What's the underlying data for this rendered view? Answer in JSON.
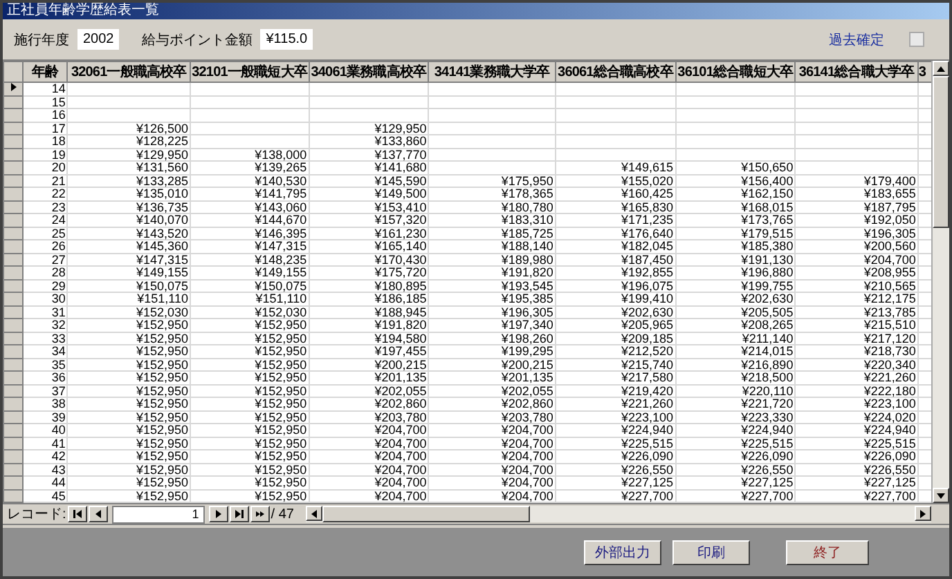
{
  "window": {
    "title": "正社員年齢学歴給表一覧"
  },
  "filters": {
    "year_label": "施行年度",
    "year_value": "2002",
    "point_label": "給与ポイント金額",
    "point_value": "¥115.0",
    "confirmed_label": "過去確定",
    "confirmed_checked": false
  },
  "table": {
    "columns": [
      "年齢",
      "32061一般職高校卒",
      "32101一般職短大卒",
      "34061業務職高校卒",
      "34141業務職大学卒",
      "36061総合職高校卒",
      "36101総合職短大卒",
      "36141総合職大学卒",
      "3"
    ],
    "rows": [
      {
        "current": true,
        "cells": [
          "14",
          null,
          null,
          null,
          null,
          null,
          null,
          null
        ]
      },
      {
        "current": false,
        "cells": [
          "15",
          null,
          null,
          null,
          null,
          null,
          null,
          null
        ]
      },
      {
        "current": false,
        "cells": [
          "16",
          null,
          null,
          null,
          null,
          null,
          null,
          null
        ]
      },
      {
        "current": false,
        "cells": [
          "17",
          "¥126,500",
          null,
          "¥129,950",
          null,
          null,
          null,
          null
        ]
      },
      {
        "current": false,
        "cells": [
          "18",
          "¥128,225",
          null,
          "¥133,860",
          null,
          null,
          null,
          null
        ]
      },
      {
        "current": false,
        "cells": [
          "19",
          "¥129,950",
          "¥138,000",
          "¥137,770",
          null,
          null,
          null,
          null
        ]
      },
      {
        "current": false,
        "cells": [
          "20",
          "¥131,560",
          "¥139,265",
          "¥141,680",
          null,
          "¥149,615",
          "¥150,650",
          null
        ]
      },
      {
        "current": false,
        "cells": [
          "21",
          "¥133,285",
          "¥140,530",
          "¥145,590",
          "¥175,950",
          "¥155,020",
          "¥156,400",
          "¥179,400"
        ]
      },
      {
        "current": false,
        "cells": [
          "22",
          "¥135,010",
          "¥141,795",
          "¥149,500",
          "¥178,365",
          "¥160,425",
          "¥162,150",
          "¥183,655"
        ]
      },
      {
        "current": false,
        "cells": [
          "23",
          "¥136,735",
          "¥143,060",
          "¥153,410",
          "¥180,780",
          "¥165,830",
          "¥168,015",
          "¥187,795"
        ]
      },
      {
        "current": false,
        "cells": [
          "24",
          "¥140,070",
          "¥144,670",
          "¥157,320",
          "¥183,310",
          "¥171,235",
          "¥173,765",
          "¥192,050"
        ]
      },
      {
        "current": false,
        "cells": [
          "25",
          "¥143,520",
          "¥146,395",
          "¥161,230",
          "¥185,725",
          "¥176,640",
          "¥179,515",
          "¥196,305"
        ]
      },
      {
        "current": false,
        "cells": [
          "26",
          "¥145,360",
          "¥147,315",
          "¥165,140",
          "¥188,140",
          "¥182,045",
          "¥185,380",
          "¥200,560"
        ]
      },
      {
        "current": false,
        "cells": [
          "27",
          "¥147,315",
          "¥148,235",
          "¥170,430",
          "¥189,980",
          "¥187,450",
          "¥191,130",
          "¥204,700"
        ]
      },
      {
        "current": false,
        "cells": [
          "28",
          "¥149,155",
          "¥149,155",
          "¥175,720",
          "¥191,820",
          "¥192,855",
          "¥196,880",
          "¥208,955"
        ]
      },
      {
        "current": false,
        "cells": [
          "29",
          "¥150,075",
          "¥150,075",
          "¥180,895",
          "¥193,545",
          "¥196,075",
          "¥199,755",
          "¥210,565"
        ]
      },
      {
        "current": false,
        "cells": [
          "30",
          "¥151,110",
          "¥151,110",
          "¥186,185",
          "¥195,385",
          "¥199,410",
          "¥202,630",
          "¥212,175"
        ]
      },
      {
        "current": false,
        "cells": [
          "31",
          "¥152,030",
          "¥152,030",
          "¥188,945",
          "¥196,305",
          "¥202,630",
          "¥205,505",
          "¥213,785"
        ]
      },
      {
        "current": false,
        "cells": [
          "32",
          "¥152,950",
          "¥152,950",
          "¥191,820",
          "¥197,340",
          "¥205,965",
          "¥208,265",
          "¥215,510"
        ]
      },
      {
        "current": false,
        "cells": [
          "33",
          "¥152,950",
          "¥152,950",
          "¥194,580",
          "¥198,260",
          "¥209,185",
          "¥211,140",
          "¥217,120"
        ]
      },
      {
        "current": false,
        "cells": [
          "34",
          "¥152,950",
          "¥152,950",
          "¥197,455",
          "¥199,295",
          "¥212,520",
          "¥214,015",
          "¥218,730"
        ]
      },
      {
        "current": false,
        "cells": [
          "35",
          "¥152,950",
          "¥152,950",
          "¥200,215",
          "¥200,215",
          "¥215,740",
          "¥216,890",
          "¥220,340"
        ]
      },
      {
        "current": false,
        "cells": [
          "36",
          "¥152,950",
          "¥152,950",
          "¥201,135",
          "¥201,135",
          "¥217,580",
          "¥218,500",
          "¥221,260"
        ]
      },
      {
        "current": false,
        "cells": [
          "37",
          "¥152,950",
          "¥152,950",
          "¥202,055",
          "¥202,055",
          "¥219,420",
          "¥220,110",
          "¥222,180"
        ]
      },
      {
        "current": false,
        "cells": [
          "38",
          "¥152,950",
          "¥152,950",
          "¥202,860",
          "¥202,860",
          "¥221,260",
          "¥221,720",
          "¥223,100"
        ]
      },
      {
        "current": false,
        "cells": [
          "39",
          "¥152,950",
          "¥152,950",
          "¥203,780",
          "¥203,780",
          "¥223,100",
          "¥223,330",
          "¥224,020"
        ]
      },
      {
        "current": false,
        "cells": [
          "40",
          "¥152,950",
          "¥152,950",
          "¥204,700",
          "¥204,700",
          "¥224,940",
          "¥224,940",
          "¥224,940"
        ]
      },
      {
        "current": false,
        "cells": [
          "41",
          "¥152,950",
          "¥152,950",
          "¥204,700",
          "¥204,700",
          "¥225,515",
          "¥225,515",
          "¥225,515"
        ]
      },
      {
        "current": false,
        "cells": [
          "42",
          "¥152,950",
          "¥152,950",
          "¥204,700",
          "¥204,700",
          "¥226,090",
          "¥226,090",
          "¥226,090"
        ]
      },
      {
        "current": false,
        "cells": [
          "43",
          "¥152,950",
          "¥152,950",
          "¥204,700",
          "¥204,700",
          "¥226,550",
          "¥226,550",
          "¥226,550"
        ]
      },
      {
        "current": false,
        "cells": [
          "44",
          "¥152,950",
          "¥152,950",
          "¥204,700",
          "¥204,700",
          "¥227,125",
          "¥227,125",
          "¥227,125"
        ]
      },
      {
        "current": false,
        "cells": [
          "45",
          "¥152,950",
          "¥152,950",
          "¥204,700",
          "¥204,700",
          "¥227,700",
          "¥227,700",
          "¥227,700"
        ]
      }
    ]
  },
  "record_nav": {
    "label": "レコード:",
    "current": "1",
    "total": "/ 47"
  },
  "buttons": [
    {
      "label": "外部出力",
      "kind": "normal"
    },
    {
      "label": "印刷",
      "kind": "normal"
    },
    {
      "label": "終了",
      "kind": "exit"
    }
  ]
}
